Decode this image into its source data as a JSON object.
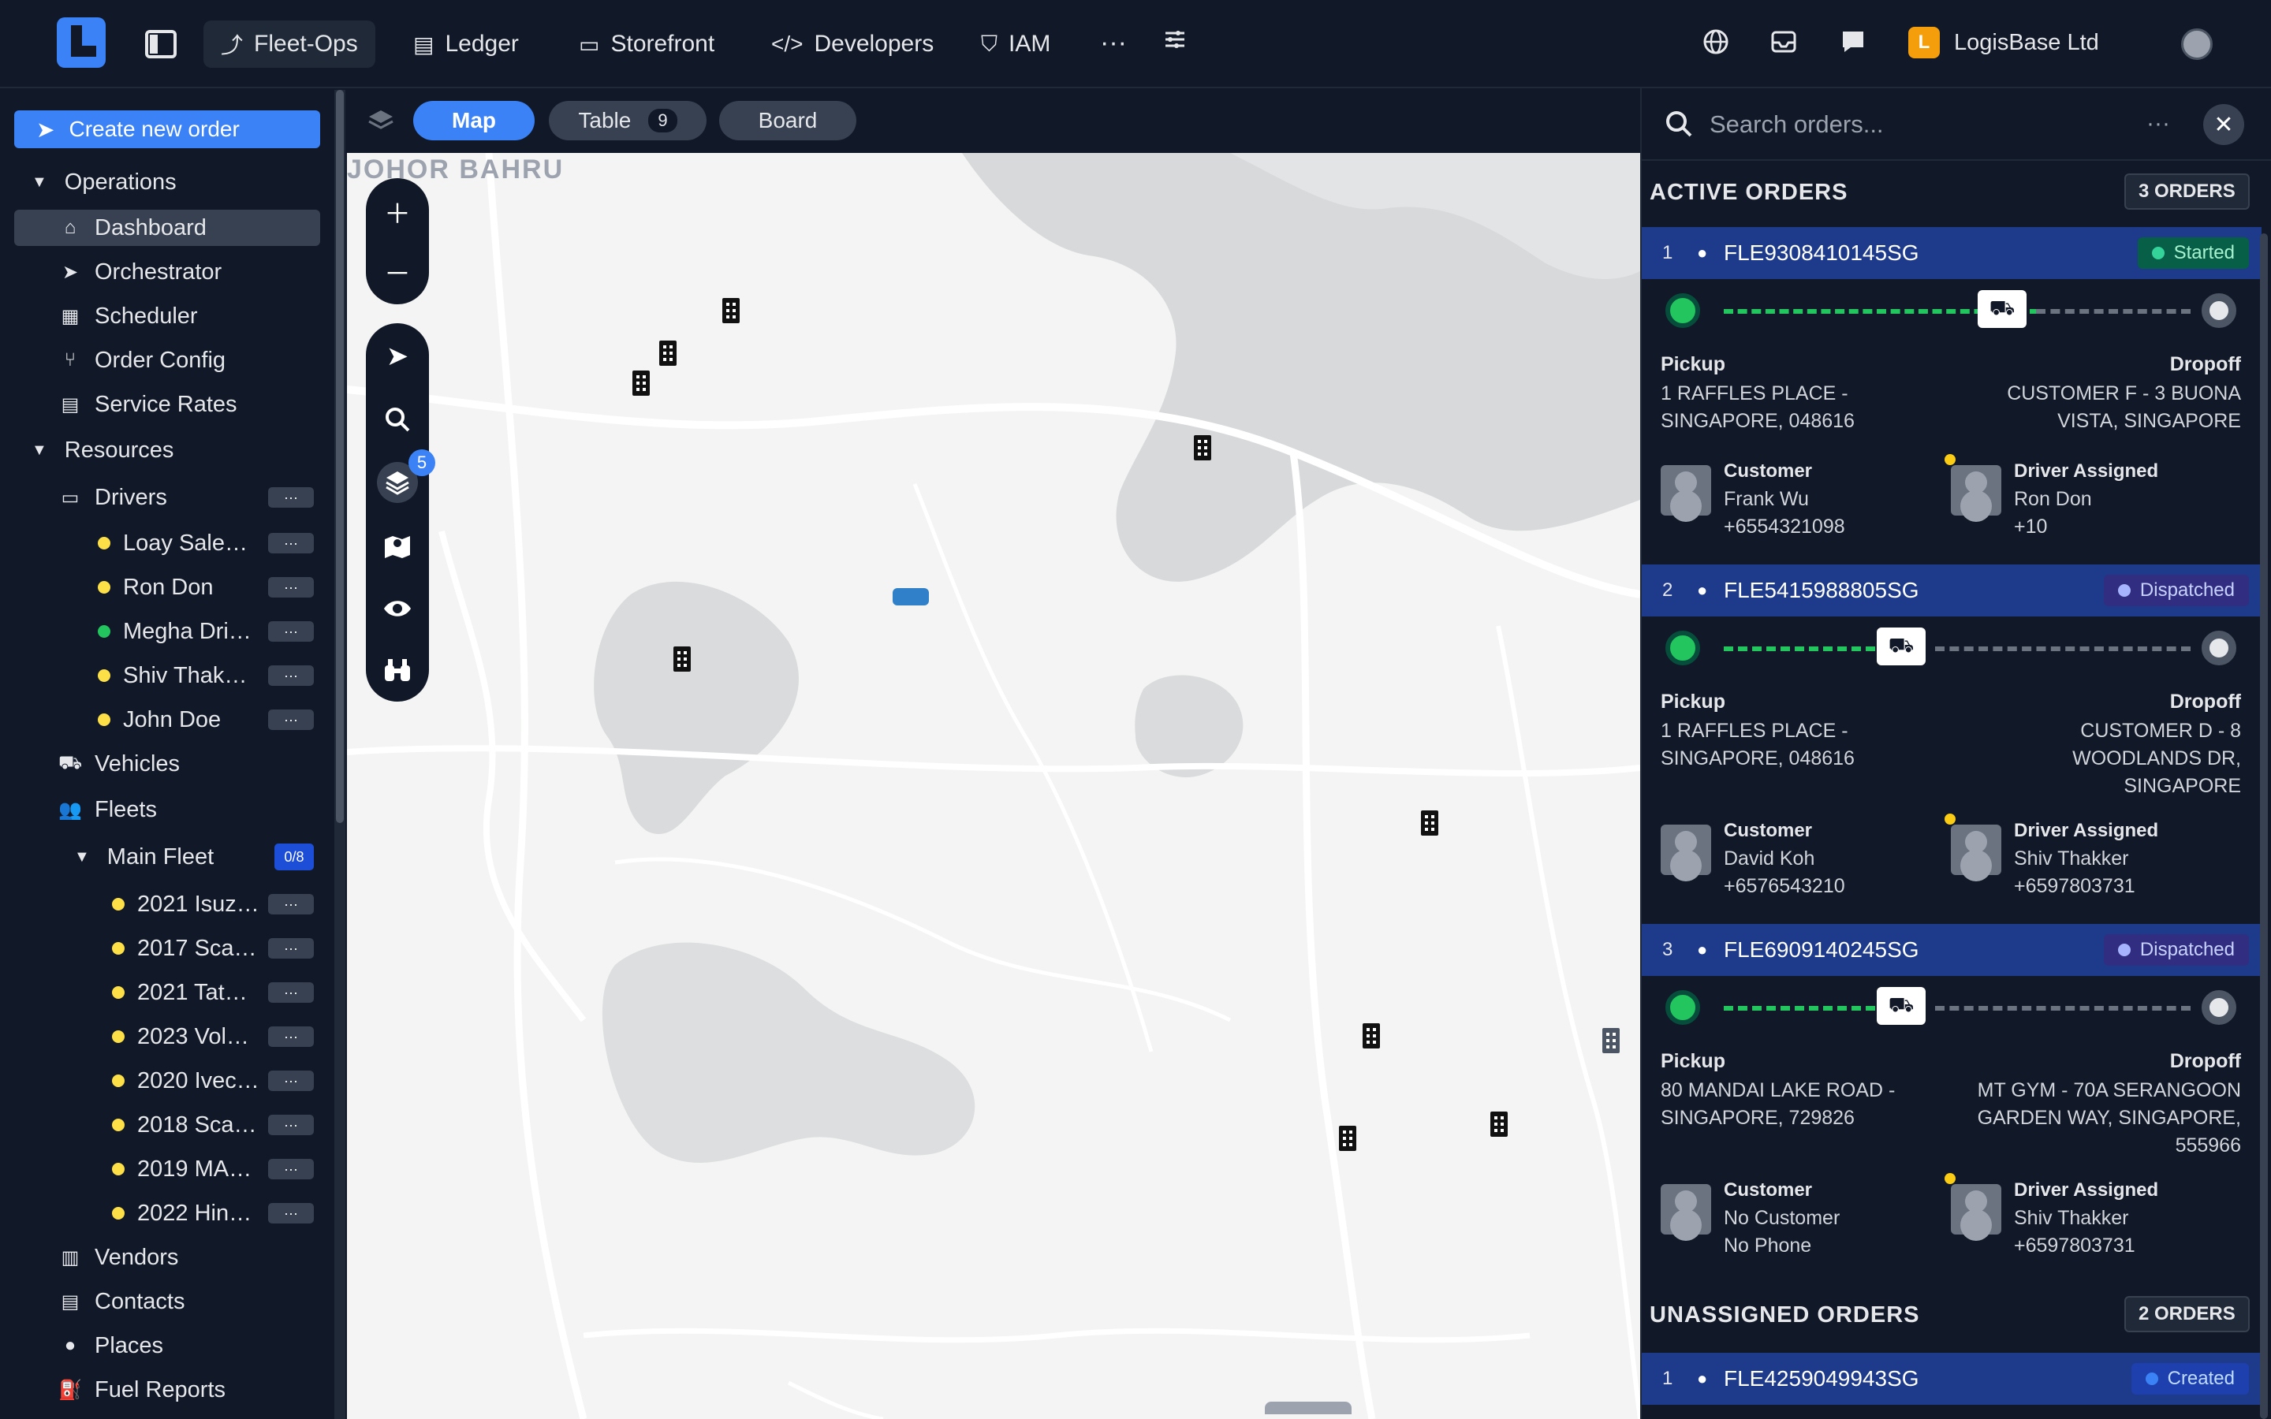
{
  "topbar": {
    "tabs": [
      {
        "label": "Fleet-Ops",
        "icon": "route-icon",
        "active": true
      },
      {
        "label": "Ledger",
        "icon": "receipt-icon"
      },
      {
        "label": "Storefront",
        "icon": "store-icon"
      },
      {
        "label": "Developers",
        "icon": "code-icon"
      },
      {
        "label": "IAM",
        "icon": "shield-icon"
      }
    ],
    "more": "···",
    "org_name": "LogisBase Ltd",
    "org_initial": "L"
  },
  "sidebar": {
    "create_button": "Create new order",
    "operations": {
      "label": "Operations",
      "items": [
        "Dashboard",
        "Orchestrator",
        "Scheduler",
        "Order Config",
        "Service Rates"
      ]
    },
    "resources": {
      "label": "Resources",
      "drivers_label": "Drivers",
      "drivers": [
        {
          "name": "Loay Sale…",
          "color": "#fde047"
        },
        {
          "name": "Ron Don",
          "color": "#fde047"
        },
        {
          "name": "Megha Dri…",
          "color": "#22c55e"
        },
        {
          "name": "Shiv Thak…",
          "color": "#fde047"
        },
        {
          "name": "John Doe",
          "color": "#fde047"
        }
      ],
      "vehicles_label": "Vehicles",
      "fleets_label": "Fleets",
      "main_fleet_label": "Main Fleet",
      "main_fleet_count": "0/8",
      "fleet_vehicles": [
        "2021 Isuz…",
        "2017 Sca…",
        "2021 Tat…",
        "2023 Vol…",
        "2020 Ivec…",
        "2018 Sca…",
        "2019 MA…",
        "2022 Hin…"
      ],
      "tail_items": [
        "Vendors",
        "Contacts",
        "Places",
        "Fuel Reports"
      ]
    },
    "more_glyph": "···"
  },
  "map": {
    "tabs": {
      "map": "Map",
      "table": "Table",
      "table_count": "9",
      "board": "Board"
    },
    "city_label": "JOHOR BAHRU",
    "layers_badge": "5"
  },
  "panel": {
    "search_placeholder": "Search orders...",
    "active_title": "ACTIVE ORDERS",
    "active_count": "3 ORDERS",
    "unassigned_title": "UNASSIGNED ORDERS",
    "unassigned_count": "2 ORDERS",
    "pickup_label": "Pickup",
    "dropoff_label": "Dropoff",
    "customer_label": "Customer",
    "driver_label": "Driver Assigned",
    "orders": [
      {
        "num": "1",
        "id": "FLE9308410145SG",
        "status": "Started",
        "pickup_1": "1 RAFFLES PLACE -",
        "pickup_2": "SINGAPORE, 048616",
        "dropoff_1": "CUSTOMER F - 3 BUONA",
        "dropoff_2": "VISTA, SINGAPORE",
        "dropoff_3": "",
        "customer_name": "Frank Wu",
        "customer_phone": "+6554321098",
        "driver_name": "Ron Don",
        "driver_phone": "+10"
      },
      {
        "num": "2",
        "id": "FLE5415988805SG",
        "status": "Dispatched",
        "pickup_1": "1 RAFFLES PLACE -",
        "pickup_2": "SINGAPORE, 048616",
        "dropoff_1": "CUSTOMER D - 8",
        "dropoff_2": "WOODLANDS DR,",
        "dropoff_3": "SINGAPORE",
        "customer_name": "David Koh",
        "customer_phone": "+6576543210",
        "driver_name": "Shiv Thakker",
        "driver_phone": "+6597803731"
      },
      {
        "num": "3",
        "id": "FLE6909140245SG",
        "status": "Dispatched",
        "pickup_1": "80 MANDAI LAKE ROAD -",
        "pickup_2": "SINGAPORE, 729826",
        "dropoff_1": "MT GYM - 70A SERANGOON",
        "dropoff_2": "GARDEN WAY, SINGAPORE,",
        "dropoff_3": "555966",
        "customer_name": "No Customer",
        "customer_phone": "No Phone",
        "driver_name": "Shiv Thakker",
        "driver_phone": "+6597803731"
      }
    ],
    "unassigned": [
      {
        "num": "1",
        "id": "FLE4259049943SG",
        "status": "Created"
      }
    ]
  },
  "colors": {
    "accent": "#3b82f6",
    "started": "#10b981",
    "dispatched": "#818cf8",
    "created": "#3b82f6"
  }
}
